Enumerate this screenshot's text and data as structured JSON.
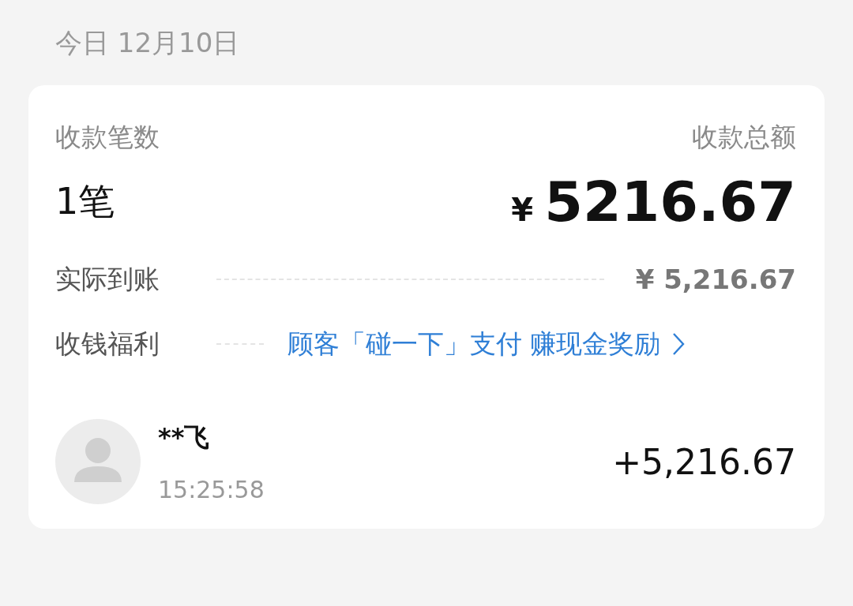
{
  "date_header": "今日 12月10日",
  "summary": {
    "count_label": "收款笔数",
    "count": "1笔",
    "total_label": "收款总额",
    "currency": "¥",
    "total": "5216.67"
  },
  "details": [
    {
      "kind": "amount",
      "label": "实际到账",
      "value": "¥ 5,216.67"
    },
    {
      "kind": "promo",
      "label": "收钱福利",
      "value": "顾客「碰一下」支付 赚现金奖励"
    }
  ],
  "transactions": [
    {
      "name": "**飞",
      "time": "15:25:58",
      "amount": "+5,216.67"
    }
  ]
}
